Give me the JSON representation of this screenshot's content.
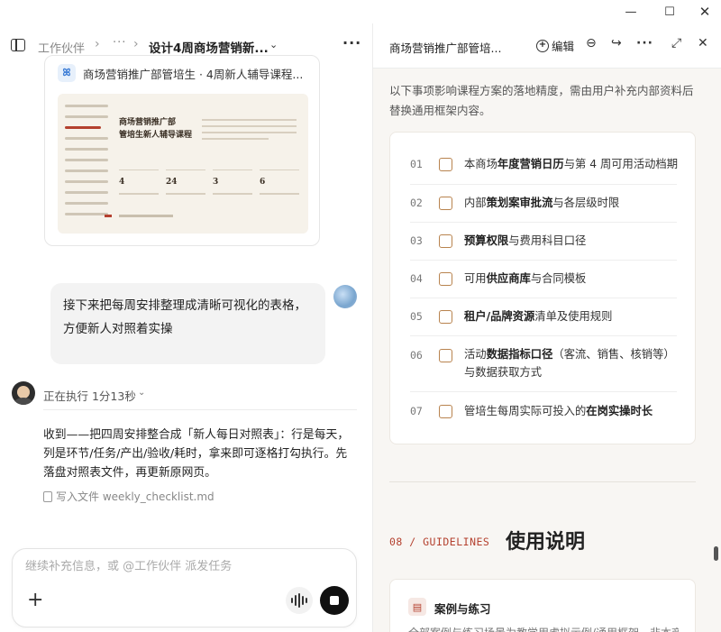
{
  "window": {
    "minimize_glyph": "—",
    "maximize_glyph": "☐",
    "close_glyph": "✕"
  },
  "left_header": {
    "breadcrumb_root": "工作伙伴",
    "breadcrumb_more": "···",
    "title": "设计4周商场营销新...",
    "chevron": "⌄",
    "more": "···"
  },
  "attachment": {
    "logo": "ꕤ",
    "title": "商场营销推广部管培生 · 4周新人辅导课程...",
    "thumb_title_1": "商场营销推广部",
    "thumb_title_2": "管培生新人辅导课程",
    "thumb_stats": [
      "4",
      "24",
      "3",
      "6"
    ]
  },
  "user_message": "接下来把每周安排整理成清晰可视化的表格，方便新人对照着实操",
  "status": {
    "text": "正在执行 1分13秒",
    "chevron": "⌄"
  },
  "agent_message": "收到——把四周安排整合成「新人每日对照表」：行是每天，列是环节/任务/产出/验收/耗时，拿来即可逐格打勾执行。先落盘对照表文件，再更新原网页。",
  "file_note": "写入文件 weekly_checklist.md",
  "composer": {
    "placeholder": "继续补充信息，或 @工作伙伴 派发任务",
    "plus": "+"
  },
  "right_header": {
    "title": "商场营销推广部管培...",
    "edit_label": "编辑",
    "icons": [
      "minus-circle-icon",
      "share-icon",
      "more-icon",
      "expand-icon",
      "close-icon"
    ]
  },
  "doc": {
    "intro": "以下事项影响课程方案的落地精度，需由用户补充内部资料后替换通用框架内容。",
    "checklist": [
      {
        "num": "01",
        "pre": "本商场",
        "bold": "年度营销日历",
        "post": "与第 4 周可用活动档期"
      },
      {
        "num": "02",
        "pre": "内部",
        "bold": "策划案审批流",
        "post": "与各层级时限"
      },
      {
        "num": "03",
        "pre": "",
        "bold": "预算权限",
        "post": "与费用科目口径"
      },
      {
        "num": "04",
        "pre": "可用",
        "bold": "供应商库",
        "post": "与合同模板"
      },
      {
        "num": "05",
        "pre": "",
        "bold": "租户/品牌资源",
        "post": "清单及使用规则"
      },
      {
        "num": "06",
        "pre": "活动",
        "bold": "数据指标口径",
        "post": "（客流、销售、核销等）与数据获取方式"
      },
      {
        "num": "07",
        "pre": "管培生每周实际可投入的",
        "bold": "在岗实操时长",
        "post": ""
      }
    ],
    "section_label": "08 / GUIDELINES",
    "section_title": "使用说明",
    "guide_title": "案例与练习",
    "guide_text": "全部案例与练习场景为教学用虚拟示例/通用框架，非本商场"
  },
  "colors": {
    "accent": "#b4412f",
    "checkbox": "#b8834e",
    "doc_bg": "#f8f6f3"
  }
}
